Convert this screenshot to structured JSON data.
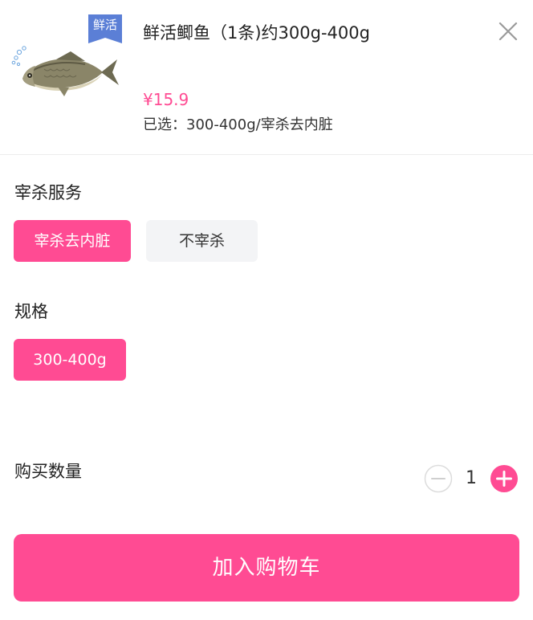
{
  "product": {
    "title": "鲜活鲫鱼（1条)约300g-400g",
    "badge": "鲜活",
    "price": "¥15.9",
    "selected_label": "已选：",
    "selected_value": "300-400g/宰杀去内脏",
    "image_icon": "fish-image"
  },
  "slaughter": {
    "title": "宰杀服务",
    "options": [
      {
        "label": "宰杀去内脏",
        "selected": true
      },
      {
        "label": "不宰杀",
        "selected": false
      }
    ]
  },
  "spec": {
    "title": "规格",
    "options": [
      {
        "label": "300-400g",
        "selected": true
      }
    ]
  },
  "quantity": {
    "label": "购买数量",
    "value": "1"
  },
  "actions": {
    "add_to_cart": "加入购物车"
  },
  "colors": {
    "accent": "#ff4b93",
    "badge": "#5b7fd6",
    "inactive_bg": "#f3f4f6"
  }
}
